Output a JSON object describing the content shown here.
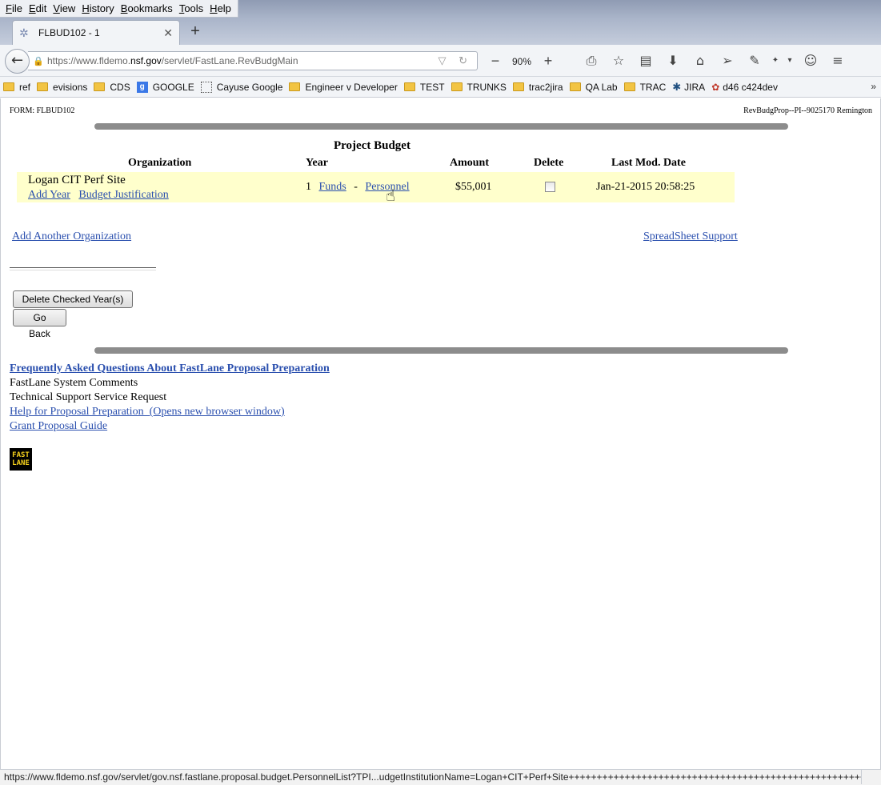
{
  "browser": {
    "menu": [
      "File",
      "Edit",
      "View",
      "History",
      "Bookmarks",
      "Tools",
      "Help"
    ],
    "tab_title": "FLBUD102 - 1",
    "url_prefix": "https://www.fldemo.",
    "url_host": "nsf.gov",
    "url_path": "/servlet/FastLane.RevBudgMain",
    "zoom": "90%",
    "bookmarks": [
      {
        "label": "ref",
        "icon": "folder-icon"
      },
      {
        "label": "evisions",
        "icon": "folder-icon"
      },
      {
        "label": "CDS",
        "icon": "folder-icon"
      },
      {
        "label": "GOOGLE",
        "icon": "google-icon"
      },
      {
        "label": "Cayuse Google",
        "icon": "page-icon"
      },
      {
        "label": "Engineer v Developer",
        "icon": "folder-icon"
      },
      {
        "label": "TEST",
        "icon": "folder-icon"
      },
      {
        "label": "TRUNKS",
        "icon": "folder-icon"
      },
      {
        "label": "trac2jira",
        "icon": "folder-icon"
      },
      {
        "label": "QA Lab",
        "icon": "folder-icon"
      },
      {
        "label": "TRAC",
        "icon": "folder-icon"
      },
      {
        "label": "JIRA",
        "icon": "jira-icon"
      },
      {
        "label": "d46 c424dev",
        "icon": "paw-icon"
      }
    ],
    "status_url": "https://www.fldemo.nsf.gov/servlet/gov.nsf.fastlane.proposal.budget.PersonnelList?TPI...udgetInstitutionName=Logan+CIT+Perf+Site+++++++++++++++++++++++++++++++++++++++++++++++++++++++++++++"
  },
  "page": {
    "form_id": "FORM: FLBUD102",
    "form_ref": "RevBudgProp--PI--9025170 Remington",
    "budget_title": "Project Budget",
    "columns": {
      "organization": "Organization",
      "year": "Year",
      "amount": "Amount",
      "delete": "Delete",
      "last_mod": "Last Mod. Date"
    },
    "row": {
      "org_name": "Logan CIT Perf Site",
      "add_year": "Add Year",
      "budget_justification": "Budget Justification",
      "year": "1",
      "funds": "Funds",
      "separator": "-",
      "personnel": "Personnel",
      "amount": "$55,001",
      "delete_checked": false,
      "last_mod": "Jan-21-2015 20:58:25"
    },
    "add_org": "Add Another Organization",
    "spreadsheet": "SpreadSheet Support",
    "buttons": {
      "delete_years": "Delete Checked Year(s)",
      "go_back": "Go Back"
    },
    "footer": {
      "faq": "Frequently Asked Questions About FastLane Proposal Preparation",
      "comments": "FastLane System Comments",
      "tech_support": "Technical Support Service Request",
      "help": "Help for Proposal Preparation  (Opens new browser window)",
      "grant_guide": "Grant Proposal Guide"
    },
    "logo_text": [
      "FAST",
      "LANE"
    ]
  }
}
